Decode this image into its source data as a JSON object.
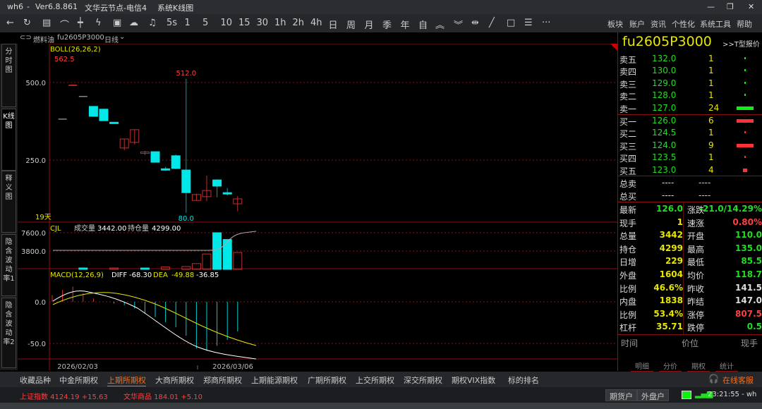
{
  "title": {
    "app": "wh6",
    "version": "Ver6.8.861",
    "node": "文华云节点-电信4",
    "view": "系统K线图"
  },
  "toolbar": {
    "periods": [
      "5s",
      "1",
      "5",
      "10",
      "15",
      "30",
      "1h",
      "2h",
      "4h",
      "日",
      "周",
      "月",
      "季",
      "年",
      "自"
    ],
    "menu": [
      "板块",
      "账户",
      "资讯",
      "个性化",
      "系统工具",
      "帮助"
    ]
  },
  "chart_header": {
    "name": "燃料油",
    "code": "fu2605P3000",
    "period": "日线"
  },
  "left_nav": [
    "分时图",
    "K线图",
    "释义图",
    "隐含波动率1",
    "隐含波动率2"
  ],
  "main": {
    "indicator": "BOLL(26,26,2)",
    "max_label": "562.5",
    "high_label": "512.0",
    "low_label": "80.0",
    "days": "19天",
    "y_ticks": [
      "500.0",
      "250.0"
    ],
    "candles": [
      [
        382,
        382,
        382,
        382
      ],
      [
        491,
        491,
        491,
        491
      ],
      [
        455,
        455,
        455,
        455
      ],
      [
        423,
        391,
        423,
        391
      ],
      [
        414,
        377,
        416,
        377
      ],
      [
        372,
        368,
        372,
        368
      ],
      [
        289,
        318,
        318,
        282
      ],
      [
        307,
        348,
        348,
        300
      ],
      [
        273,
        276,
        280,
        266
      ],
      [
        277,
        243,
        277,
        243
      ],
      [
        222,
        220,
        228,
        215
      ],
      [
        264,
        223,
        268,
        221
      ],
      [
        218,
        145,
        512,
        80
      ],
      [
        120,
        139,
        142,
        120
      ],
      [
        132,
        152,
        200,
        118
      ],
      [
        186,
        166,
        188,
        130
      ],
      [
        145,
        143,
        160,
        136
      ],
      [
        109,
        125,
        134,
        85
      ]
    ],
    "x_labels": [
      "2026/02/03",
      "2026/03/06"
    ]
  },
  "volume": {
    "indicator": "CJL",
    "vol_label": "成交量",
    "vol": "3442.00",
    "oi_label": "持仓量",
    "oi": "4299.00",
    "y_ticks": [
      "7600.0",
      "3800.0"
    ],
    "bars": [
      0,
      0,
      0,
      300,
      0,
      0,
      250,
      0,
      0,
      280,
      0,
      500,
      0,
      600,
      1200,
      3200,
      7600,
      6200,
      3500
    ]
  },
  "macd": {
    "indicator": "MACD(12,26,9)",
    "diff_label": "DIFF",
    "diff": "-68.30",
    "dea_label": "DEA",
    "dea": "-49.88",
    "macd": "-36.85",
    "y_ticks": [
      "0.0",
      "-50.0"
    ],
    "hist": [
      8,
      14,
      18,
      10,
      4,
      0,
      -2,
      -4,
      -8,
      -14,
      -18,
      -24,
      -30,
      -40,
      -55,
      -58,
      -52,
      -45,
      -35
    ]
  },
  "quote": {
    "code": "fu2605P3000",
    "t_link": ">>T型报价",
    "asks": [
      [
        "卖五",
        "132.0",
        "1"
      ],
      [
        "卖四",
        "130.0",
        "1"
      ],
      [
        "卖三",
        "129.0",
        "1"
      ],
      [
        "卖二",
        "128.0",
        "1"
      ],
      [
        "卖一",
        "127.0",
        "24"
      ]
    ],
    "bids": [
      [
        "买一",
        "126.0",
        "6"
      ],
      [
        "买二",
        "124.5",
        "1"
      ],
      [
        "买三",
        "124.0",
        "9"
      ],
      [
        "买四",
        "123.5",
        "1"
      ],
      [
        "买五",
        "123.0",
        "4"
      ]
    ],
    "totals": [
      [
        "总卖",
        "----",
        "----"
      ],
      [
        "总买",
        "----",
        "----"
      ]
    ],
    "stats": [
      [
        "最新",
        "126.0",
        "涨跌",
        "-21.0/14.29%"
      ],
      [
        "现手",
        "1",
        "速涨",
        "0.80%"
      ],
      [
        "总量",
        "3442",
        "开盘",
        "110.0"
      ],
      [
        "持仓",
        "4299",
        "最高",
        "135.0"
      ],
      [
        "日增",
        "229",
        "最低",
        "85.5"
      ],
      [
        "外盘",
        "1604",
        "均价",
        "118.7"
      ],
      [
        "比例",
        "46.6%",
        "昨收",
        "141.5"
      ],
      [
        "内盘",
        "1838",
        "昨结",
        "147.0"
      ],
      [
        "比例",
        "53.4%",
        "涨停",
        "807.5"
      ],
      [
        "杠杆",
        "35.71",
        "跌停",
        "0.5"
      ]
    ],
    "tick_headers": [
      "时间",
      "价位",
      "现手"
    ],
    "tabs": [
      "明细",
      "分价",
      "期权",
      "统计"
    ]
  },
  "exchange_tabs": [
    "收藏品种",
    "中金所期权",
    "上期所期权",
    "大商所期权",
    "郑商所期权",
    "上期能源期权",
    "广期所期权",
    "上交所期权",
    "深交所期权",
    "期权VIX指数",
    "标的排名"
  ],
  "status": {
    "idx1": "上证指数 4124.19 +15.63",
    "idx2": "文华商品 184.01 +5.10",
    "btn1": "期货户",
    "btn2": "外盘户",
    "service": "在线客服",
    "time": "23:21:55 - wh"
  }
}
